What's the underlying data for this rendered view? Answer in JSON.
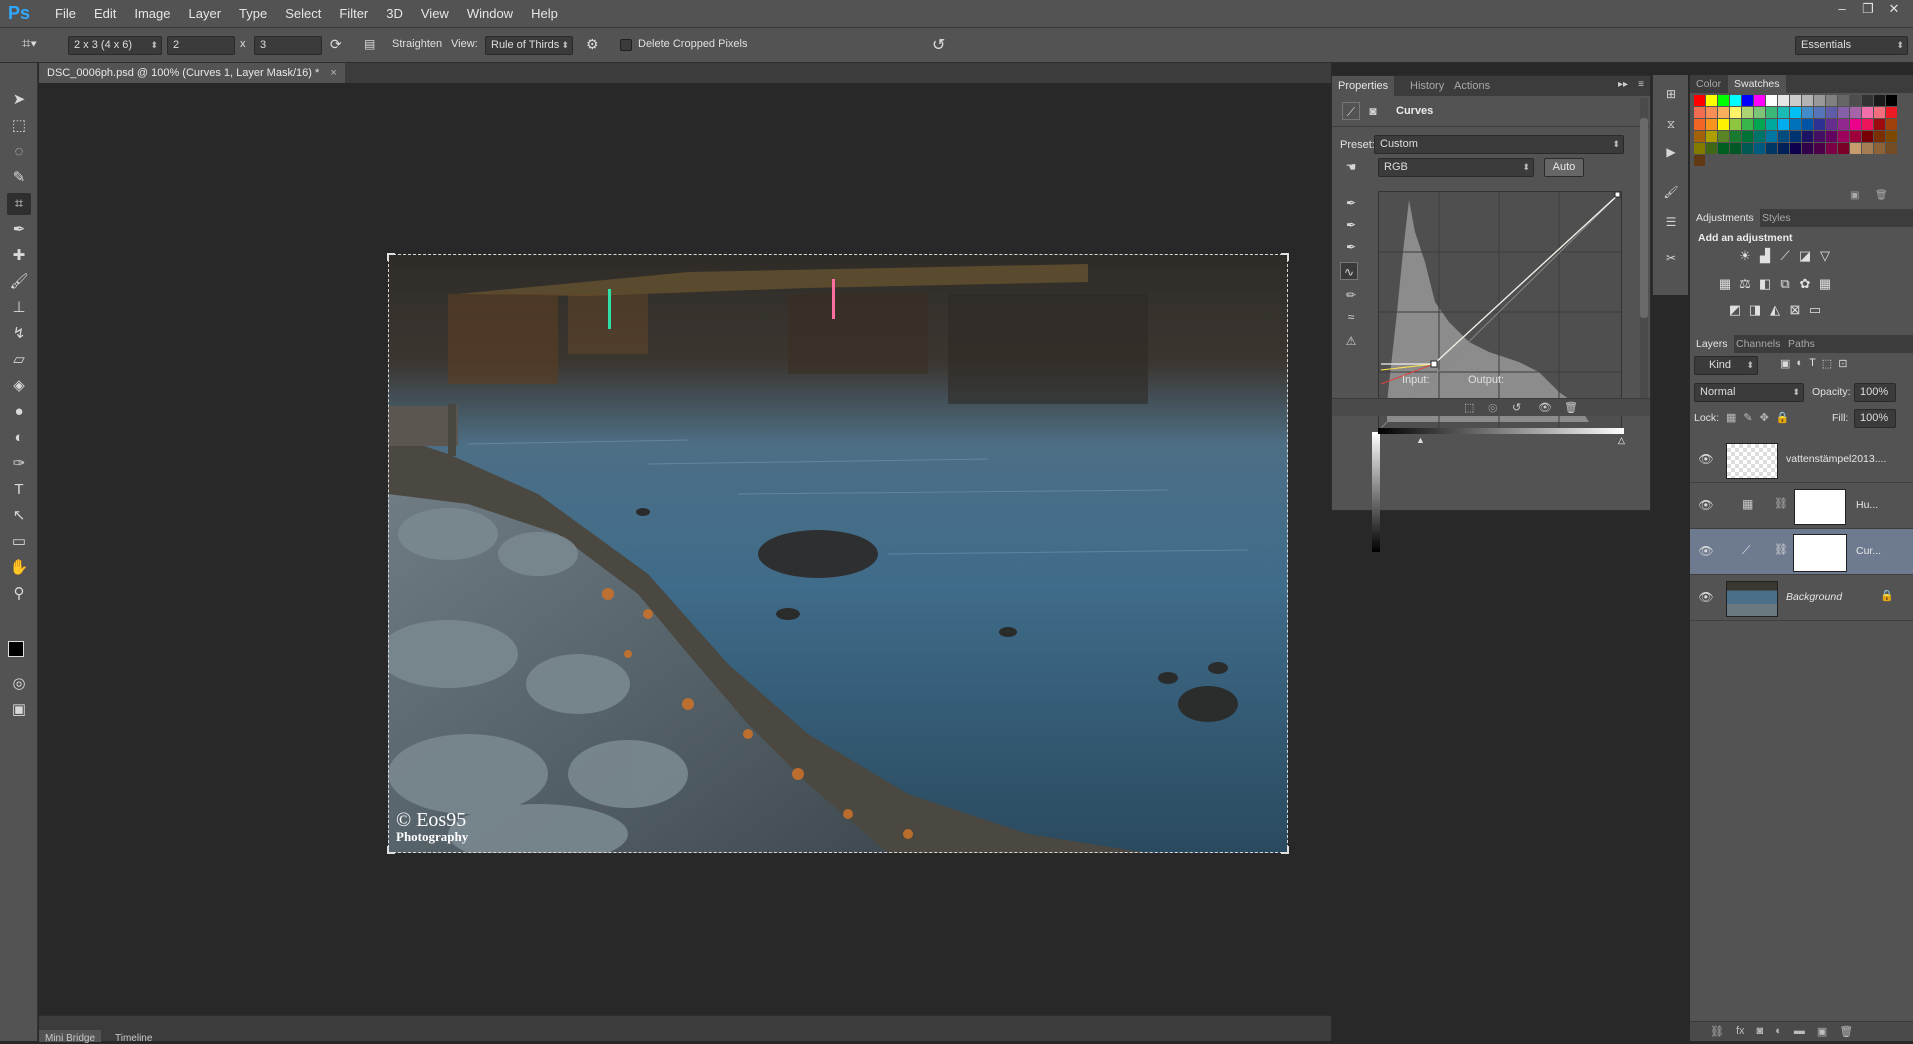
{
  "app": {
    "logo": "Ps"
  },
  "menu": [
    "File",
    "Edit",
    "Image",
    "Layer",
    "Type",
    "Select",
    "Filter",
    "3D",
    "View",
    "Window",
    "Help"
  ],
  "window_controls": [
    "–",
    "❐",
    "✕"
  ],
  "options": {
    "ratio_preset": "2 x 3 (4 x 6)",
    "width": "2",
    "times": "x",
    "height": "3",
    "straighten_label": "Straighten",
    "view_label": "View:",
    "view_value": "Rule of Thirds",
    "delete_cropped_label": "Delete Cropped Pixels",
    "workspace": "Essentials"
  },
  "document": {
    "tab_title": "DSC_0006ph.psd @ 100% (Curves 1, Layer Mask/16) *",
    "tab_close": "×",
    "watermark_line1": "© Eos95",
    "watermark_line2": "Photography"
  },
  "bottom_tabs": {
    "mini_bridge": "Mini Bridge",
    "timeline": "Timeline"
  },
  "properties": {
    "tabs": [
      "Properties",
      "History",
      "Actions"
    ],
    "title": "Curves",
    "preset_label": "Preset:",
    "preset_value": "Custom",
    "channel_value": "RGB",
    "auto_label": "Auto",
    "input_label": "Input:",
    "output_label": "Output:"
  },
  "color_panel": {
    "tabs": [
      "Color",
      "Swatches"
    ]
  },
  "swatch_colors": [
    "#ff0000",
    "#ffff00",
    "#00ff00",
    "#00ffff",
    "#0000ff",
    "#ff00ff",
    "#ffffff",
    "#e6e6e6",
    "#cccccc",
    "#b3b3b3",
    "#999999",
    "#808080",
    "#666666",
    "#4d4d4d",
    "#333333",
    "#1a1a1a",
    "#000000",
    "#f26c4f",
    "#f68e55",
    "#fbaf5c",
    "#fff467",
    "#acd372",
    "#7cc576",
    "#3bb878",
    "#1abbb4",
    "#00bff3",
    "#438cca",
    "#5574b9",
    "#605ca8",
    "#855fa8",
    "#a763a8",
    "#f06ea9",
    "#f26d7d",
    "#ed1c24",
    "#f26522",
    "#f7941d",
    "#fff200",
    "#8dc63f",
    "#39b54a",
    "#00a651",
    "#00a99d",
    "#00aeef",
    "#0072bc",
    "#0054a6",
    "#2e3192",
    "#662d91",
    "#92278f",
    "#ec008c",
    "#ed145b",
    "#9e0b0f",
    "#a0410d",
    "#a36209",
    "#aba000",
    "#598527",
    "#1a7b30",
    "#007236",
    "#00746b",
    "#0076a3",
    "#004b80",
    "#003471",
    "#1b1464",
    "#440e62",
    "#630460",
    "#9e005d",
    "#9e0039",
    "#790000",
    "#7b2e00",
    "#7d4900",
    "#827b00",
    "#406618",
    "#005e20",
    "#005826",
    "#005952",
    "#005b7f",
    "#003663",
    "#002157",
    "#0d004c",
    "#32004b",
    "#4b0049",
    "#7b0046",
    "#7a0026",
    "#c69c6d",
    "#a67c52",
    "#8c6239",
    "#754c24",
    "#603913"
  ],
  "adjustments": {
    "tabs": [
      "Adjustments",
      "Styles"
    ],
    "heading": "Add an adjustment"
  },
  "layers_panel": {
    "tabs": [
      "Layers",
      "Channels",
      "Paths"
    ],
    "filter_kind": "Kind",
    "blend_mode": "Normal",
    "opacity_label": "Opacity:",
    "opacity_value": "100%",
    "lock_label": "Lock:",
    "fill_label": "Fill:",
    "fill_value": "100%",
    "layers": [
      {
        "name": "vattenstämpel2013...."
      },
      {
        "name": "Hu..."
      },
      {
        "name": "Cur..."
      },
      {
        "name": "Background"
      }
    ]
  }
}
